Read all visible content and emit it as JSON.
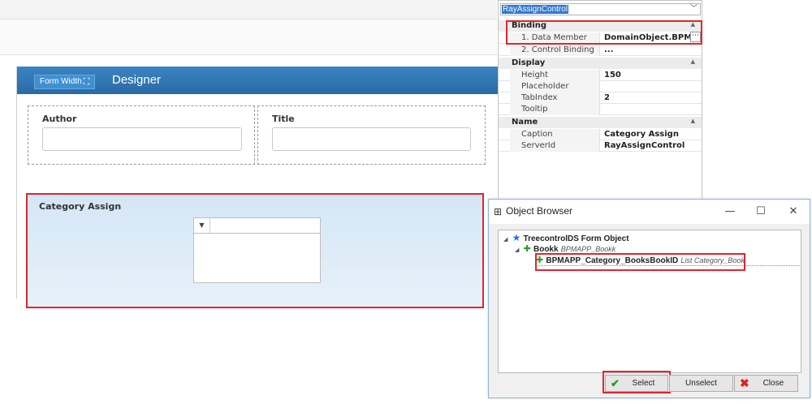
{
  "designer": {
    "form_width_label": "Form Width",
    "title": "Designer",
    "fields": [
      {
        "label": "Author",
        "value": ""
      },
      {
        "label": "Title",
        "value": ""
      }
    ],
    "category_section": {
      "label": "Category Assign"
    }
  },
  "property_grid": {
    "selected_control": "RayAssignControl",
    "categories": [
      {
        "name": "Binding",
        "rows": [
          {
            "name": "1. Data Member",
            "value": "DomainObject.BPMA..."
          },
          {
            "name": "2. Control Binding",
            "value": "..."
          }
        ]
      },
      {
        "name": "Display",
        "rows": [
          {
            "name": "Height",
            "value": "150"
          },
          {
            "name": "Placeholder",
            "value": ""
          },
          {
            "name": "TabIndex",
            "value": "2"
          },
          {
            "name": "Tooltip",
            "value": ""
          }
        ]
      },
      {
        "name": "Name",
        "rows": [
          {
            "name": "Caption",
            "value": "Category Assign"
          },
          {
            "name": "ServerId",
            "value": "RayAssignControl"
          }
        ]
      }
    ],
    "ellipsis": "···"
  },
  "object_browser": {
    "title": "Object Browser",
    "window_controls": {
      "minimize": "—",
      "maximize": "☐",
      "close": "✕"
    },
    "tree": {
      "root": {
        "label": "TreecontrolDS Form Object"
      },
      "child": {
        "label": "Bookk",
        "type": "BPMAPP_Bookk"
      },
      "grandchild": {
        "label": "BPMAPP_Category_BooksBookID",
        "type": "List Category_Book"
      }
    },
    "buttons": {
      "select": "Select",
      "unselect": "Unselect",
      "close": "Close"
    }
  },
  "colors": {
    "accent": "#2f75b5",
    "highlight": "#e0262d",
    "selection": "#3079d0"
  }
}
